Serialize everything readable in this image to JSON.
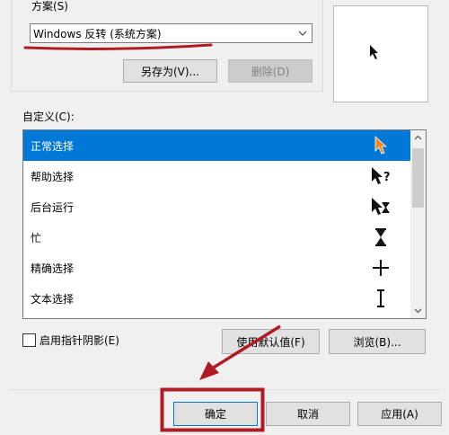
{
  "scheme": {
    "label": "方案(S)",
    "selected": "Windows 反转 (系统方案)",
    "save_as": "另存为(V)...",
    "delete": "删除(D)"
  },
  "customize": {
    "label": "自定义(C):",
    "items": [
      {
        "label": "正常选择",
        "icon": "orange-arrow-cursor-icon"
      },
      {
        "label": "帮助选择",
        "icon": "help-select-cursor-icon"
      },
      {
        "label": "后台运行",
        "icon": "working-in-background-cursor-icon"
      },
      {
        "label": "忙",
        "icon": "hourglass-icon"
      },
      {
        "label": "精确选择",
        "icon": "crosshair-icon"
      },
      {
        "label": "文本选择",
        "icon": "i-beam-icon"
      }
    ],
    "shadow_checkbox": "启用指针阴影(E)",
    "use_default": "使用默认值(F)",
    "browse": "浏览(B)..."
  },
  "footer": {
    "ok": "确定",
    "cancel": "取消",
    "apply": "应用(A)"
  },
  "colors": {
    "selection": "#0078d7",
    "annotation": "#b01c24"
  }
}
